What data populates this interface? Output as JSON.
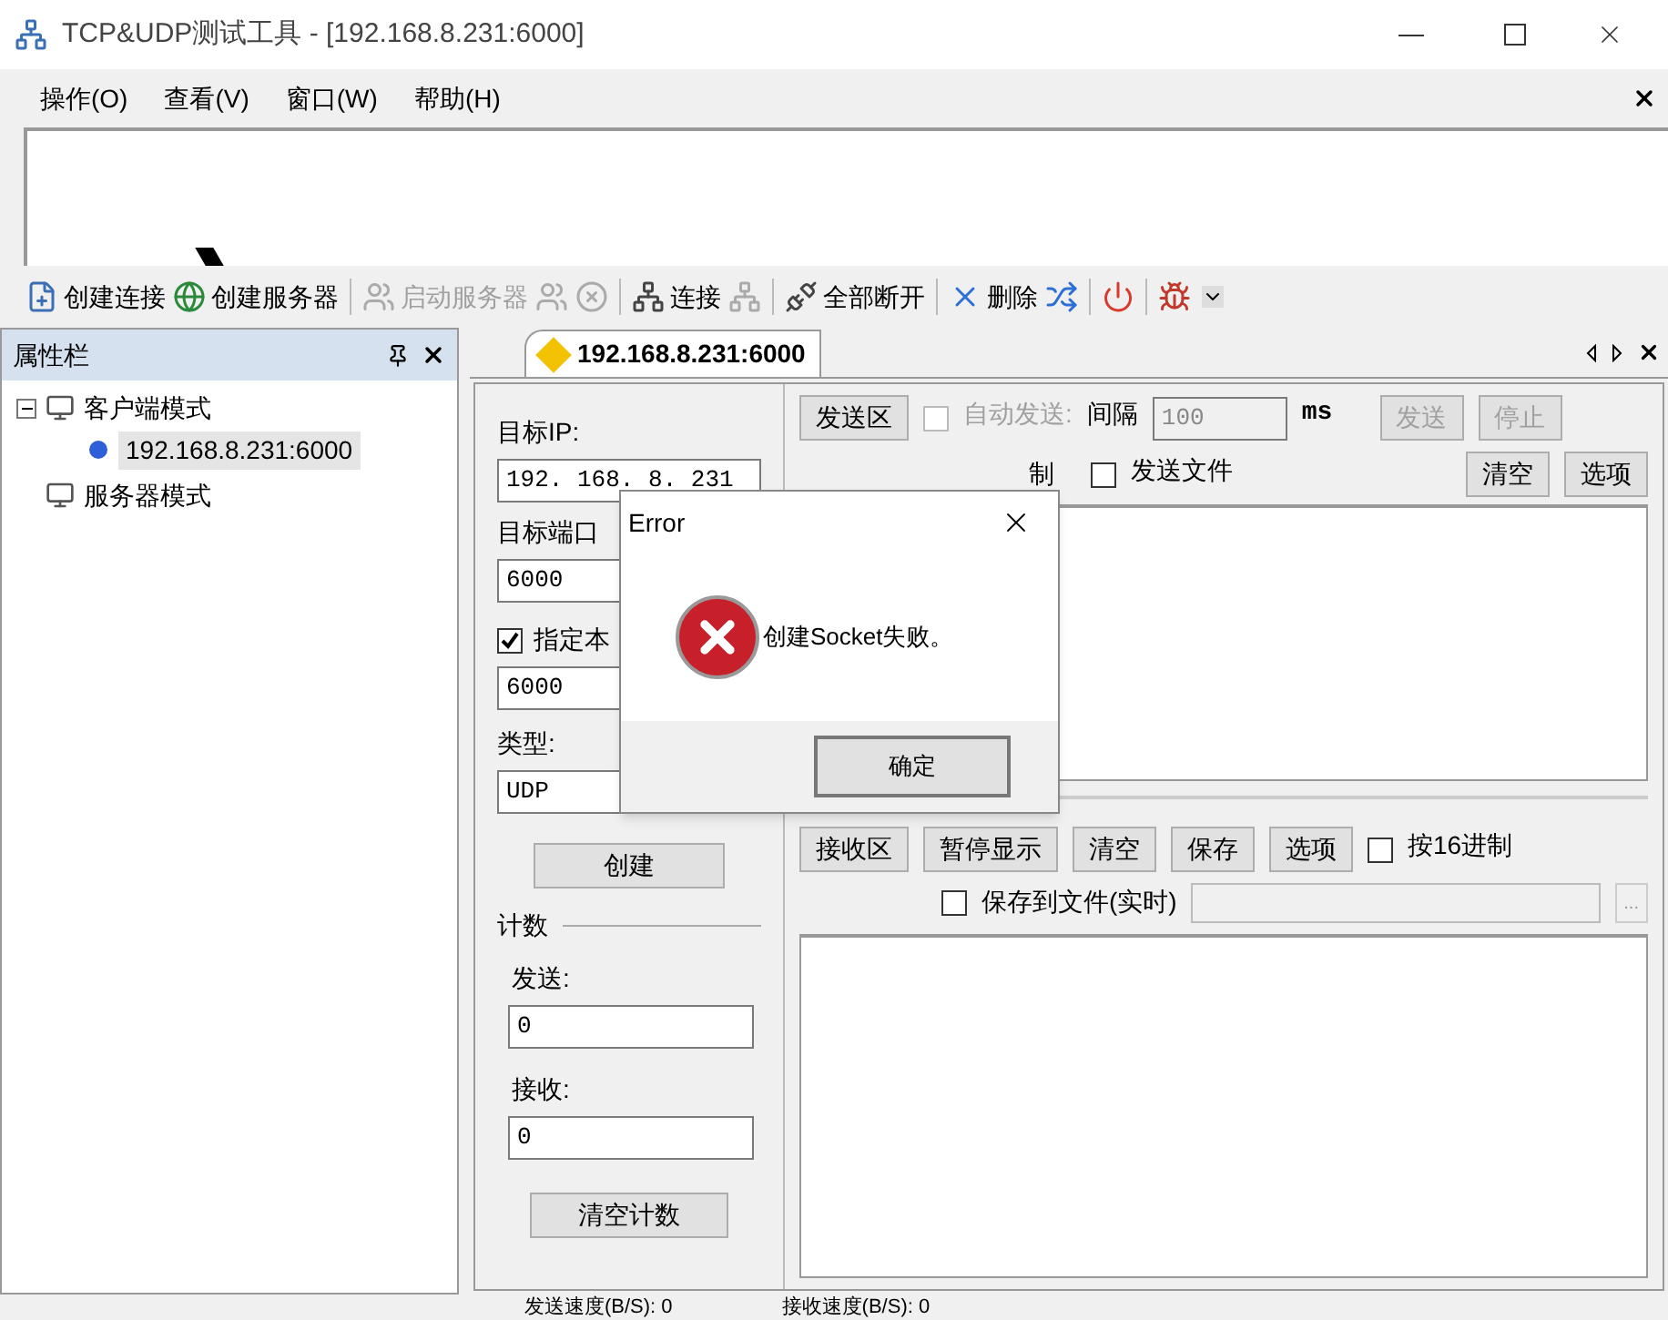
{
  "window": {
    "title": "TCP&UDP测试工具 - [192.168.8.231:6000]"
  },
  "menu": [
    "操作(O)",
    "查看(V)",
    "窗口(W)",
    "帮助(H)"
  ],
  "toolbar": [
    {
      "kind": "button",
      "label": "创建连接",
      "disabled": false
    },
    {
      "kind": "button",
      "label": "创建服务器",
      "disabled": false
    },
    {
      "kind": "separator"
    },
    {
      "kind": "button",
      "label": "启动服务器",
      "disabled": true
    },
    {
      "kind": "icon",
      "disabled": true
    },
    {
      "kind": "icon",
      "disabled": true
    },
    {
      "kind": "separator"
    },
    {
      "kind": "button",
      "label": "连接",
      "disabled": false
    },
    {
      "kind": "icon",
      "disabled": true
    },
    {
      "kind": "separator"
    },
    {
      "kind": "button",
      "label": "全部断开",
      "disabled": false
    },
    {
      "kind": "separator"
    },
    {
      "kind": "button",
      "label": "删除",
      "disabled": false
    },
    {
      "kind": "icon",
      "disabled": false
    },
    {
      "kind": "separator"
    },
    {
      "kind": "icon",
      "disabled": false
    },
    {
      "kind": "separator"
    },
    {
      "kind": "icon",
      "disabled": false
    }
  ],
  "panel": {
    "title": "属性栏",
    "tree": [
      {
        "label": "客户端模式",
        "expanded": true,
        "children": [
          {
            "label": "192.168.8.231:6000",
            "selected": true
          }
        ]
      },
      {
        "label": "服务器模式"
      }
    ]
  },
  "tabs": [
    {
      "label": "192.168.8.231:6000",
      "selected": true
    }
  ],
  "form": {
    "target_ip": {
      "label": "目标IP:",
      "value": "192. 168. 8. 231"
    },
    "target_port": {
      "label": "目标端口",
      "value": "6000"
    },
    "local_port": {
      "label": "指定本",
      "checked": true,
      "value": "6000"
    },
    "type": {
      "label": "类型:",
      "value": "UDP"
    },
    "create_button": "创建",
    "count_title": "计数",
    "sent": {
      "label": "发送:",
      "value": "0"
    },
    "received": {
      "label": "接收:",
      "value": "0"
    },
    "clear_count_button": "清空计数"
  },
  "send_area": {
    "area_button": "发送区",
    "auto_send": {
      "label": "自动发送:",
      "checked": false,
      "disabled": true
    },
    "interval_label": "间隔",
    "interval_value": "100",
    "unit": "ms",
    "send_button": {
      "label": "发送",
      "disabled": true
    },
    "stop_button": {
      "label": "停止",
      "disabled": true
    },
    "hex_label_fragment": "制",
    "send_file": {
      "label": "发送文件",
      "checked": false
    },
    "clear_button": "清空",
    "options_button": "选项"
  },
  "receive_area": {
    "area_button": "接收区",
    "pause_button": "暂停显示",
    "clear_button": "清空",
    "save_button": "保存",
    "options_button": "选项",
    "hex": {
      "label": "按16进制",
      "checked": false
    },
    "save_to_file": {
      "label": "保存到文件(实时)",
      "checked": false
    },
    "browse_button": "..."
  },
  "dialog": {
    "title": "Error",
    "message": "创建Socket失败。",
    "ok_button": "确定"
  },
  "status_bar": [
    "发送速度(B/S): 0",
    "接收速度(B/S): 0"
  ]
}
